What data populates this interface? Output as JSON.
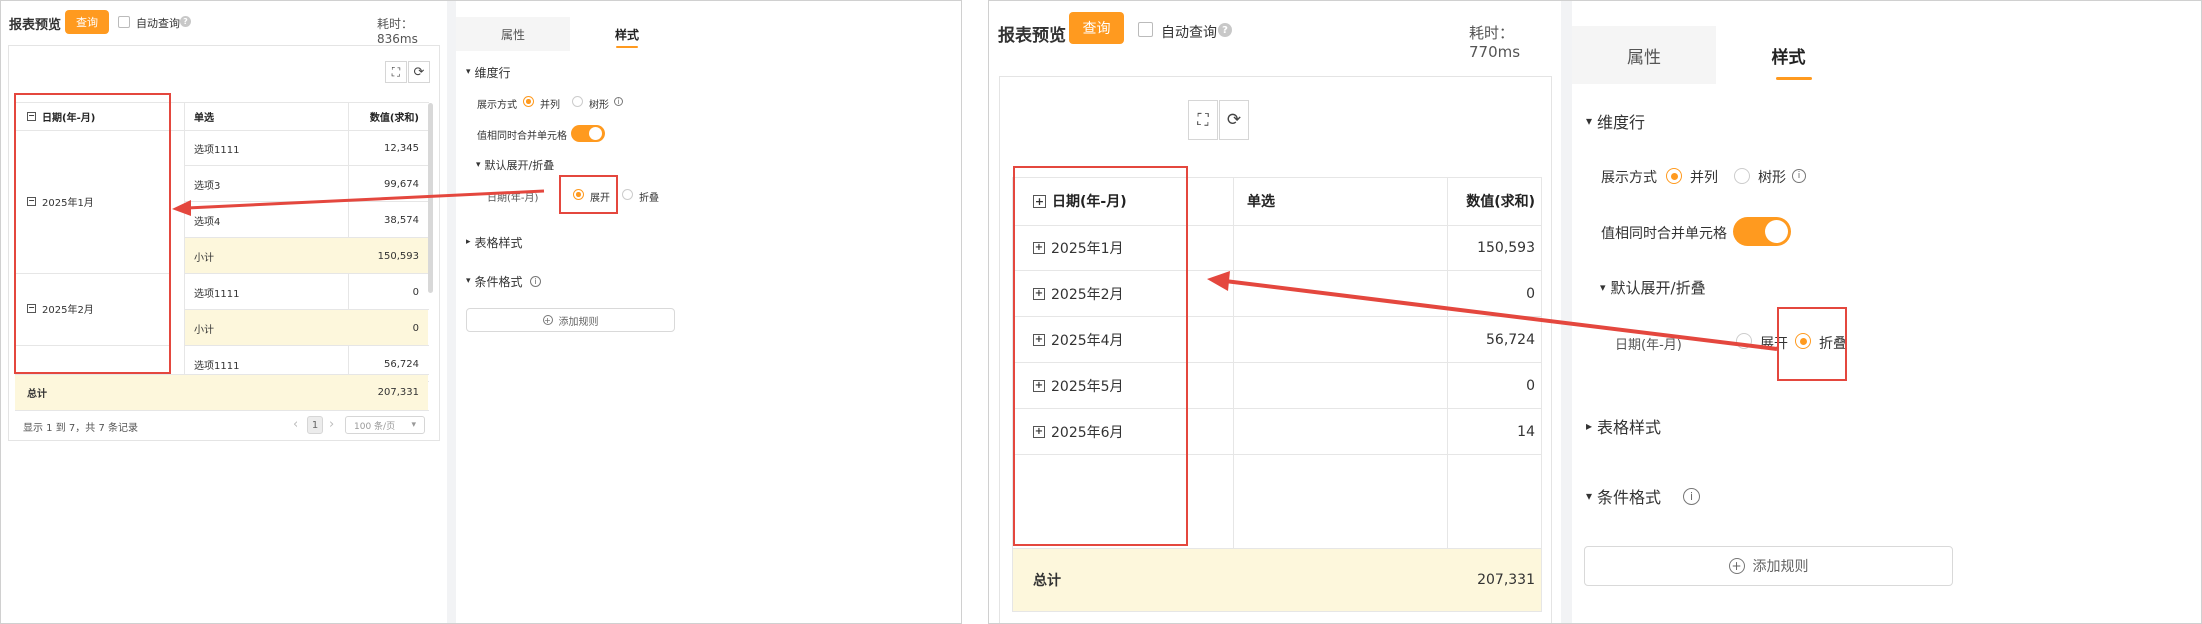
{
  "toolbar": {
    "title": "报表预览",
    "query_label": "查询",
    "auto_query_label": "自动查询",
    "help_glyph": "?"
  },
  "panel1": {
    "elapsed": "耗时：836ms",
    "headers": [
      "日期(年-月)",
      "单选",
      "数值(求和)"
    ],
    "groups": [
      "2025年1月",
      "2025年2月"
    ],
    "rows": [
      {
        "label": "选项1111",
        "value": "12,345",
        "subtotal": false
      },
      {
        "label": "选项3",
        "value": "99,674",
        "subtotal": false
      },
      {
        "label": "选项4",
        "value": "38,574",
        "subtotal": false
      },
      {
        "label": "小计",
        "value": "150,593",
        "subtotal": true
      },
      {
        "label": "选项1111",
        "value": "0",
        "subtotal": false
      },
      {
        "label": "小计",
        "value": "0",
        "subtotal": true
      },
      {
        "label": "选项1111",
        "value": "56,724",
        "subtotal": false
      }
    ],
    "total_label": "总计",
    "total_value": "207,331",
    "footer": "显示 1 到 7，共 7 条记录",
    "page": "1",
    "page_size": "100 条/页",
    "prev": "‹",
    "next": "›"
  },
  "panel2": {
    "elapsed": "耗时：770ms",
    "headers": [
      "日期(年-月)",
      "单选",
      "数值(求和)"
    ],
    "rows": [
      {
        "label": "2025年1月",
        "value": "150,593"
      },
      {
        "label": "2025年2月",
        "value": "0"
      },
      {
        "label": "2025年4月",
        "value": "56,724"
      },
      {
        "label": "2025年5月",
        "value": "0"
      },
      {
        "label": "2025年6月",
        "value": "14"
      }
    ],
    "total_label": "总计",
    "total_value": "207,331"
  },
  "settings": {
    "tab_properties": "属性",
    "tab_style": "样式",
    "dimension_rows": "维度行",
    "display_mode": "展示方式",
    "option_parallel": "并列",
    "option_tree": "树形",
    "merge_cells": "值相同时合并单元格",
    "default_expand": "默认展开/折叠",
    "date_field": "日期(年-月)",
    "option_expand": "展开",
    "option_collapse": "折叠",
    "table_style": "表格样式",
    "conditional_format": "条件格式",
    "add_rule": "添加规则",
    "info_glyph": "i",
    "plus_glyph": "+"
  },
  "colors": {
    "accent": "#ff9a1f",
    "highlight_box": "#e4473e",
    "subtotal_bg": "#fdf7dc"
  },
  "icons": {
    "expand": "⛶",
    "refresh": "⟳",
    "caret_down": "▾",
    "caret_right": "▸",
    "minus_box": "−",
    "plus_box": "+"
  }
}
